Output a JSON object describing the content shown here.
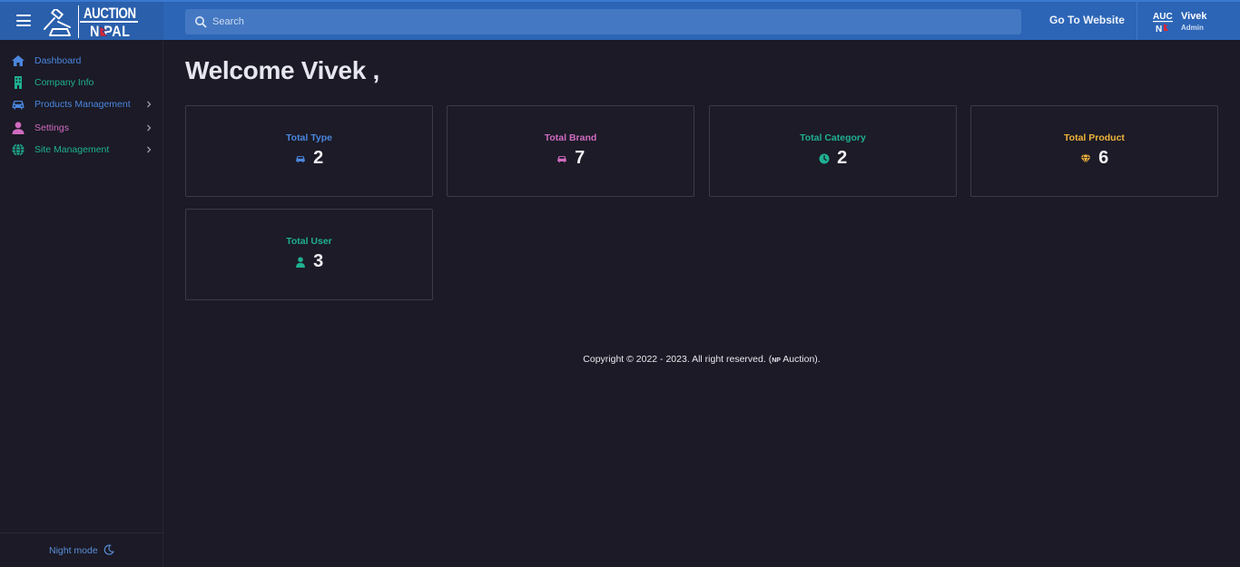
{
  "header": {
    "logo_line1": "AUCTION",
    "logo_line2": "N PAL",
    "search_placeholder": "Search",
    "go_to_website": "Go To Website",
    "user_name": "Vivek",
    "user_role": "Admin",
    "bar_color": "#2c65b6"
  },
  "sidebar": {
    "items": [
      {
        "label": "Dashboard",
        "icon": "home-icon",
        "color": "#4a86de"
      },
      {
        "label": "Company Info",
        "icon": "building-icon",
        "color": "#1fb091"
      },
      {
        "label": "Products Management",
        "icon": "car-icon",
        "color": "#4a86de"
      },
      {
        "label": "Settings",
        "icon": "user-icon",
        "color": "#d06bc0"
      },
      {
        "label": "Site Management",
        "icon": "globe-icon",
        "color": "#1fb091"
      }
    ],
    "night_mode": "Night mode"
  },
  "main": {
    "welcome": "Welcome Vivek ,",
    "cards": [
      {
        "title": "Total Type",
        "value": "2",
        "icon": "car-icon",
        "color": "#4a86de"
      },
      {
        "title": "Total Brand",
        "value": "7",
        "icon": "car-icon",
        "color": "#d06bc0"
      },
      {
        "title": "Total Category",
        "value": "2",
        "icon": "clock-icon",
        "color": "#1fb091"
      },
      {
        "title": "Total Product",
        "value": "6",
        "icon": "gem-icon",
        "color": "#f0b53a"
      },
      {
        "title": "Total User",
        "value": "3",
        "icon": "user-icon",
        "color": "#1fb091"
      }
    ]
  },
  "footer": {
    "copyright_pre": "Copyright © 2022 - 2023. All right reserved. (",
    "copyright_np": "NP",
    "copyright_post": " Auction)."
  }
}
